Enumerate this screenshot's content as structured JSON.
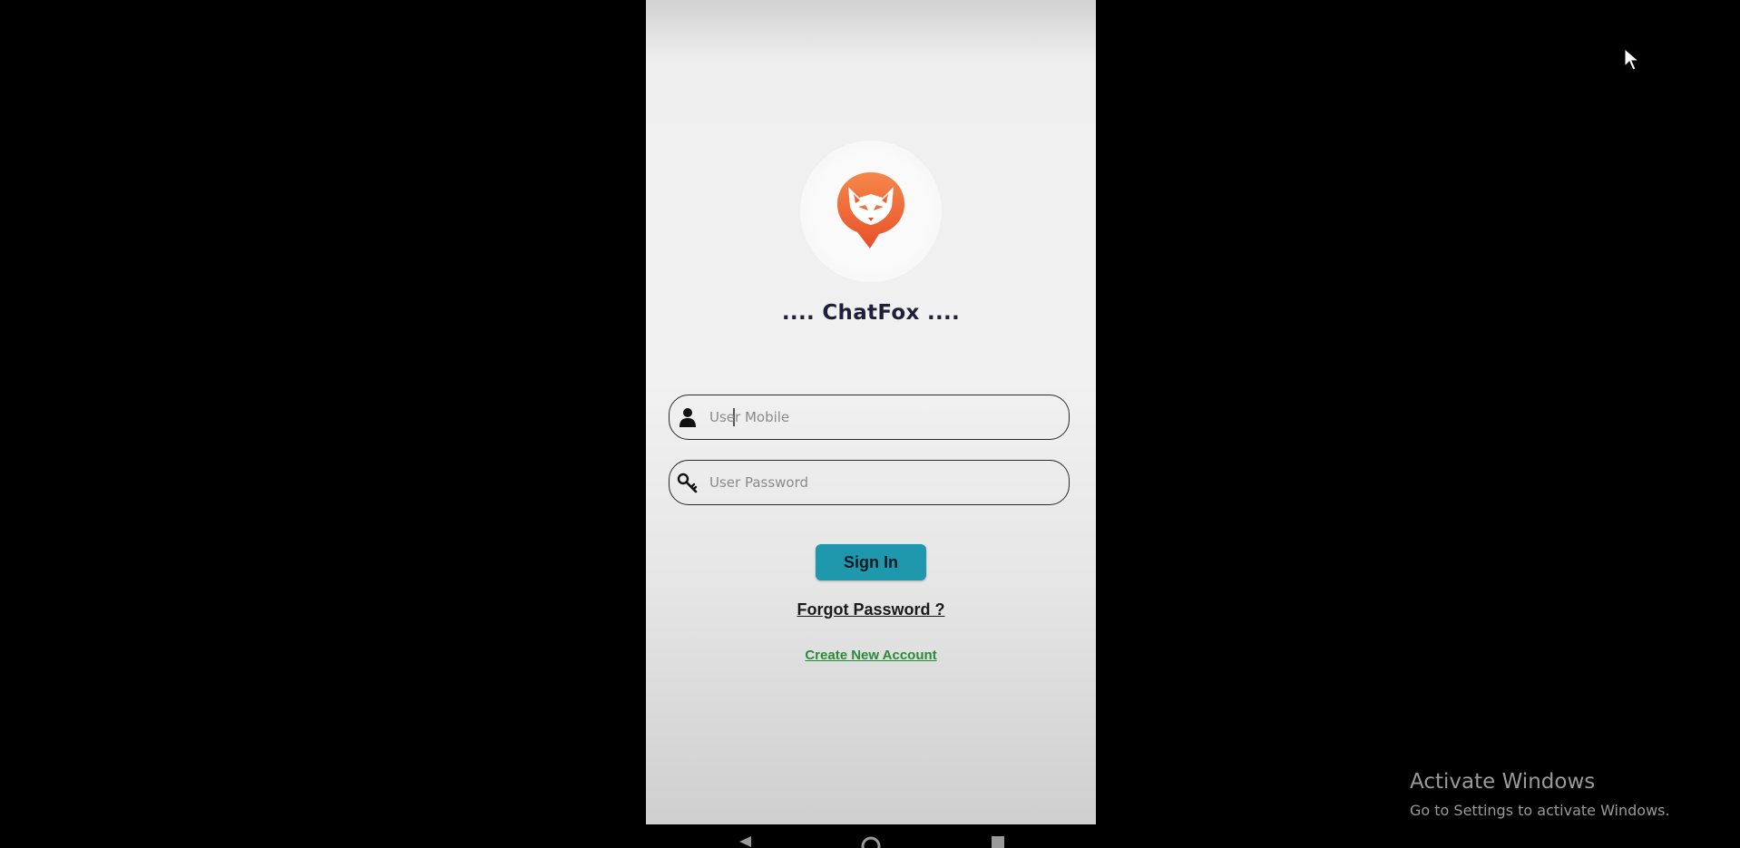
{
  "app": {
    "title": ".... ChatFox ....",
    "logo_icon": "fox-chat-bubble-logo",
    "accent_color": "#f26a2e"
  },
  "login_form": {
    "mobile_field": {
      "icon": "user-icon",
      "placeholder": "User Mobile",
      "value": ""
    },
    "password_field": {
      "icon": "key-icon",
      "placeholder": "User Password",
      "value": ""
    },
    "sign_in_label": "Sign In",
    "sign_in_color": "#1f98ad",
    "forgot_password_label": "Forgot Password ?",
    "create_account_label": "Create New Account",
    "create_account_color": "#2a8a3a"
  },
  "navigation_bar": {
    "buttons": [
      "back-icon",
      "home-icon",
      "recents-icon"
    ]
  },
  "watermark": {
    "title": "Activate Windows",
    "subtitle": "Go to Settings to activate Windows."
  }
}
